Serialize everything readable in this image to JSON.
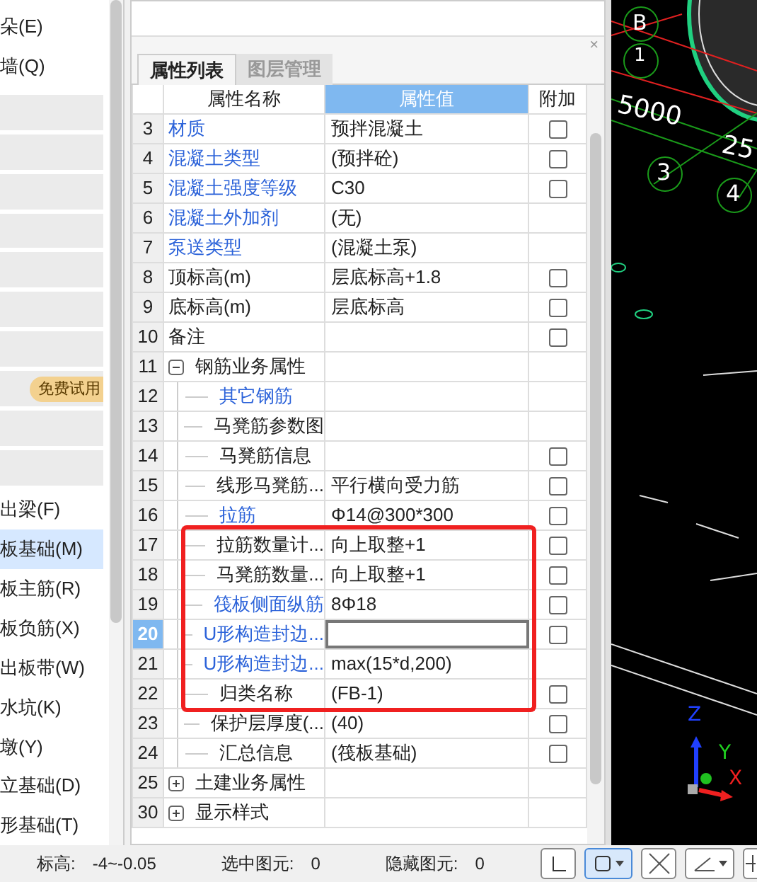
{
  "sidebar": {
    "items": [
      {
        "kind": "text",
        "label": "朵(E)",
        "selected": false
      },
      {
        "kind": "text",
        "label": "墙(Q)",
        "selected": false
      },
      {
        "kind": "blank"
      },
      {
        "kind": "blank"
      },
      {
        "kind": "blank"
      },
      {
        "kind": "blank"
      },
      {
        "kind": "blank"
      },
      {
        "kind": "blank"
      },
      {
        "kind": "blank"
      },
      {
        "kind": "blank",
        "badge": "免费试用"
      },
      {
        "kind": "blank"
      },
      {
        "kind": "blank"
      },
      {
        "kind": "text",
        "label": "出梁(F)",
        "selected": false
      },
      {
        "kind": "text",
        "label": "板基础(M)",
        "selected": true
      },
      {
        "kind": "text",
        "label": "板主筋(R)",
        "selected": false
      },
      {
        "kind": "text",
        "label": "板负筋(X)",
        "selected": false
      },
      {
        "kind": "text",
        "label": "出板带(W)",
        "selected": false
      },
      {
        "kind": "text",
        "label": "水坑(K)",
        "selected": false
      },
      {
        "kind": "text",
        "label": "墩(Y)",
        "selected": false
      },
      {
        "kind": "text",
        "label": "立基础(D)",
        "selected": false
      },
      {
        "kind": "text",
        "label": "形基础(T)",
        "selected": false
      }
    ]
  },
  "panel": {
    "close": "×",
    "tabs": [
      {
        "label": "属性列表",
        "selected": true
      },
      {
        "label": "图层管理",
        "selected": false
      }
    ],
    "columns": [
      "属性名称",
      "属性值",
      "附加"
    ],
    "rows": [
      {
        "num": "3",
        "name": "材质",
        "value": "预拌混凝土",
        "link": true,
        "kind": "checkbox",
        "checked": false
      },
      {
        "num": "4",
        "name": "混凝土类型",
        "value": "(预拌砼)",
        "link": true,
        "kind": "checkbox",
        "checked": false
      },
      {
        "num": "5",
        "name": "混凝土强度等级",
        "value": "C30",
        "link": true,
        "kind": "checkbox",
        "checked": false
      },
      {
        "num": "6",
        "name": "混凝土外加剂",
        "value": "(无)",
        "link": true,
        "kind": "plain"
      },
      {
        "num": "7",
        "name": "泵送类型",
        "value": "(混凝土泵)",
        "link": true,
        "kind": "plain"
      },
      {
        "num": "8",
        "name": "顶标高(m)",
        "value": "层底标高+1.8",
        "link": false,
        "kind": "checkbox",
        "checked": false
      },
      {
        "num": "9",
        "name": "底标高(m)",
        "value": "层底标高",
        "link": false,
        "kind": "checkbox",
        "checked": false
      },
      {
        "num": "10",
        "name": "备注",
        "link": false,
        "kind": "checkbox",
        "checked": false
      },
      {
        "num": "11",
        "name": "钢筋业务属性",
        "link": false,
        "kind": "plain",
        "expanded": true,
        "children": [
          {
            "num": "12",
            "name": "其它钢筋",
            "link": true,
            "kind": "plain"
          },
          {
            "num": "13",
            "name": "马凳筋参数图",
            "link": false,
            "kind": "plain"
          },
          {
            "num": "14",
            "name": "马凳筋信息",
            "link": false,
            "kind": "checkbox",
            "checked": false
          },
          {
            "num": "15",
            "name": "线形马凳筋...",
            "value": "平行横向受力筋",
            "link": false,
            "kind": "checkbox",
            "checked": false
          },
          {
            "num": "16",
            "name": "拉筋",
            "value": "Φ14@300*300",
            "link": true,
            "kind": "checkbox",
            "checked": false
          },
          {
            "num": "17",
            "name": "拉筋数量计...",
            "value": "向上取整+1",
            "link": false,
            "kind": "checkbox",
            "checked": false,
            "highlighted": true
          },
          {
            "num": "18",
            "name": "马凳筋数量...",
            "value": "向上取整+1",
            "link": false,
            "kind": "checkbox",
            "checked": false,
            "highlighted": true
          },
          {
            "num": "19",
            "name": "筏板侧面纵筋",
            "value": "8Φ18",
            "link": true,
            "kind": "checkbox",
            "checked": false,
            "highlighted": true
          },
          {
            "num": "20",
            "name": "U形构造封边...",
            "link": true,
            "kind": "checkbox",
            "checked": false,
            "highlighted": true,
            "selected": true
          },
          {
            "num": "21",
            "name": "U形构造封边...",
            "value": "max(15*d,200)",
            "link": true,
            "kind": "plain",
            "highlighted": true
          },
          {
            "num": "22",
            "name": "归类名称",
            "value": "(FB-1)",
            "link": false,
            "kind": "checkbox",
            "checked": false,
            "highlighted": true
          },
          {
            "num": "23",
            "name": "保护层厚度(...",
            "value": "(40)",
            "link": false,
            "kind": "checkbox",
            "checked": false
          },
          {
            "num": "24",
            "name": "汇总信息",
            "value": "(筏板基础)",
            "link": false,
            "kind": "checkbox",
            "checked": false
          }
        ]
      },
      {
        "num": "25",
        "name": "土建业务属性",
        "link": false,
        "kind": "plain",
        "expanded": false
      },
      {
        "num": "30",
        "name": "显示样式",
        "link": false,
        "kind": "plain",
        "expanded": false
      }
    ]
  },
  "canvas": {
    "labels": [
      "B",
      "1",
      "5000",
      "25",
      "3",
      "4"
    ],
    "axes": [
      "Z",
      "Y",
      "X"
    ]
  },
  "status_bar": [
    {
      "label": "标高:",
      "value": "-4~-0.05"
    },
    {
      "label": "选中图元:",
      "value": "0"
    },
    {
      "label": "隐藏图元:",
      "value": "0"
    }
  ]
}
